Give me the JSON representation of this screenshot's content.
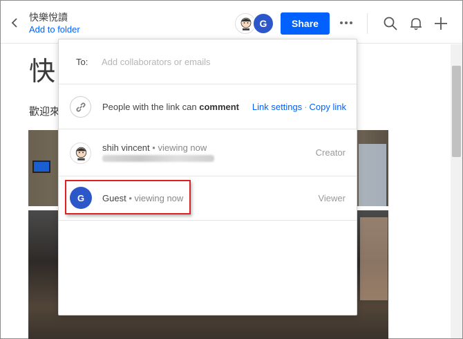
{
  "header": {
    "doc_title": "快樂悅讀",
    "add_to_folder": "Add to folder",
    "share_label": "Share",
    "guest_initial": "G"
  },
  "document": {
    "heading": "快",
    "text": "歡迎來"
  },
  "share_popup": {
    "to_label": "To:",
    "to_placeholder": "Add collaborators or emails",
    "link_text_prefix": "People with the link can",
    "link_permission": "comment",
    "link_settings": "Link settings",
    "link_separator": "·",
    "copy_link": "Copy link",
    "members": [
      {
        "name": "shih vincent",
        "status": "• viewing now",
        "role": "Creator"
      },
      {
        "name": "Guest",
        "initial": "G",
        "status": "• viewing now",
        "role": "Viewer"
      }
    ]
  },
  "colors": {
    "accent": "#0061fe",
    "guest_avatar": "#2b57c9",
    "highlight": "#e02020"
  }
}
